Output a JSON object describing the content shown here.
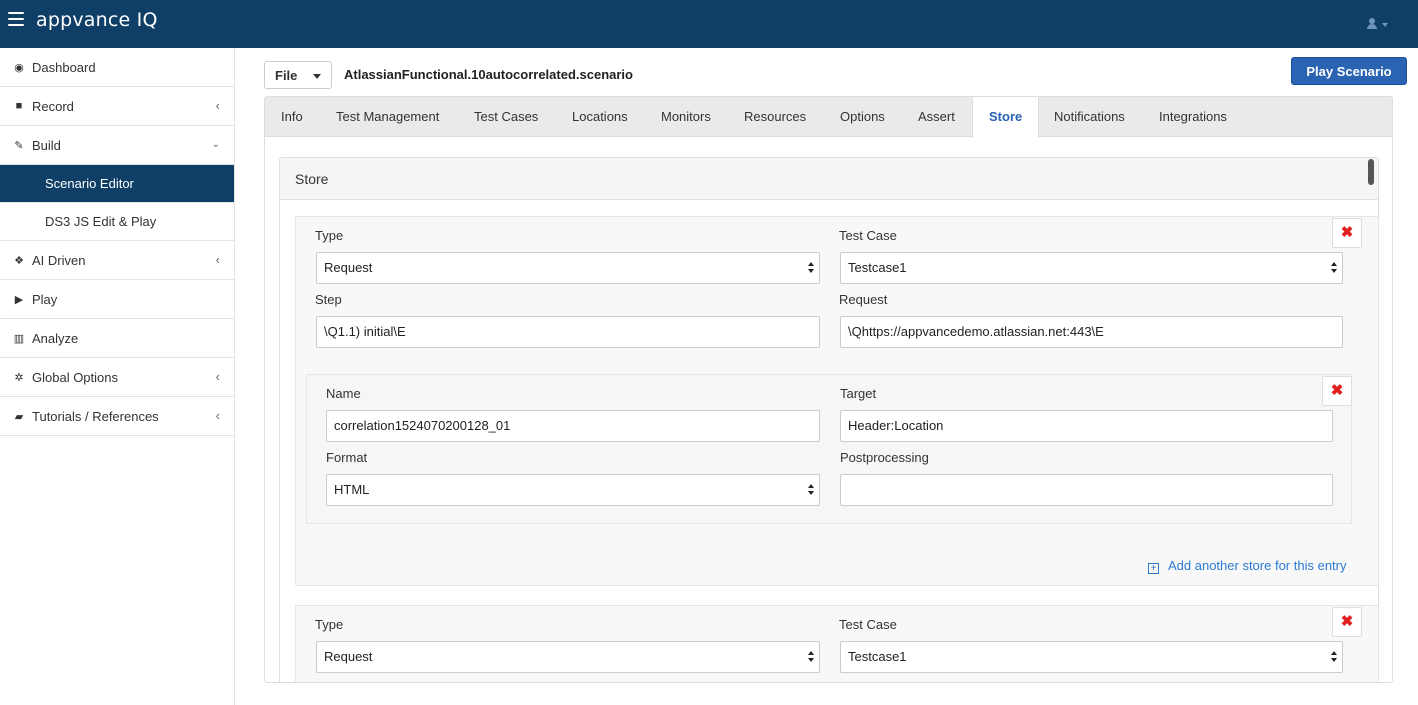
{
  "app": {
    "brand": "appvance IQ"
  },
  "sidebar": {
    "items": [
      {
        "icon": "dashboard-icon",
        "glyph": "◉",
        "label": "Dashboard"
      },
      {
        "icon": "video-camera-icon",
        "glyph": "■",
        "label": "Record"
      },
      {
        "icon": "wrench-icon",
        "glyph": "✎",
        "label": "Build"
      },
      {
        "label": "Scenario Editor"
      },
      {
        "label": "DS3 JS Edit & Play"
      },
      {
        "icon": "robot-icon",
        "glyph": "❖",
        "label": "AI Driven"
      },
      {
        "icon": "play-icon",
        "glyph": "▶",
        "label": "Play"
      },
      {
        "icon": "bar-chart-icon",
        "glyph": "▥",
        "label": "Analyze"
      },
      {
        "icon": "gears-icon",
        "glyph": "✲",
        "label": "Global Options"
      },
      {
        "icon": "book-icon",
        "glyph": "▰",
        "label": "Tutorials / References"
      }
    ]
  },
  "header": {
    "file_label": "File",
    "scenario_name": "AtlassianFunctional.10autocorrelated.scenario",
    "play_label": "Play Scenario"
  },
  "tabs": [
    "Info",
    "Test Management",
    "Test Cases",
    "Locations",
    "Monitors",
    "Resources",
    "Options",
    "Assert",
    "Store",
    "Notifications",
    "Integrations"
  ],
  "active_tab": "Store",
  "store": {
    "title": "Store",
    "labels": {
      "type": "Type",
      "test_case": "Test Case",
      "step": "Step",
      "request": "Request",
      "name": "Name",
      "target": "Target",
      "format": "Format",
      "postprocessing": "Postprocessing"
    },
    "entry1": {
      "type": "Request",
      "test_case": "Testcase1",
      "step": "\\Q1.1) initial\\E",
      "request": "\\Qhttps://appvancedemo.atlassian.net:443\\E",
      "store": {
        "name": "correlation1524070200128_01",
        "target": "Header:Location",
        "format": "HTML",
        "postprocessing": ""
      },
      "add_store_label": "Add another store for this entry"
    },
    "entry2": {
      "type": "Request",
      "test_case": "Testcase1"
    },
    "delete_glyph": "✖",
    "add_glyph": "+"
  }
}
